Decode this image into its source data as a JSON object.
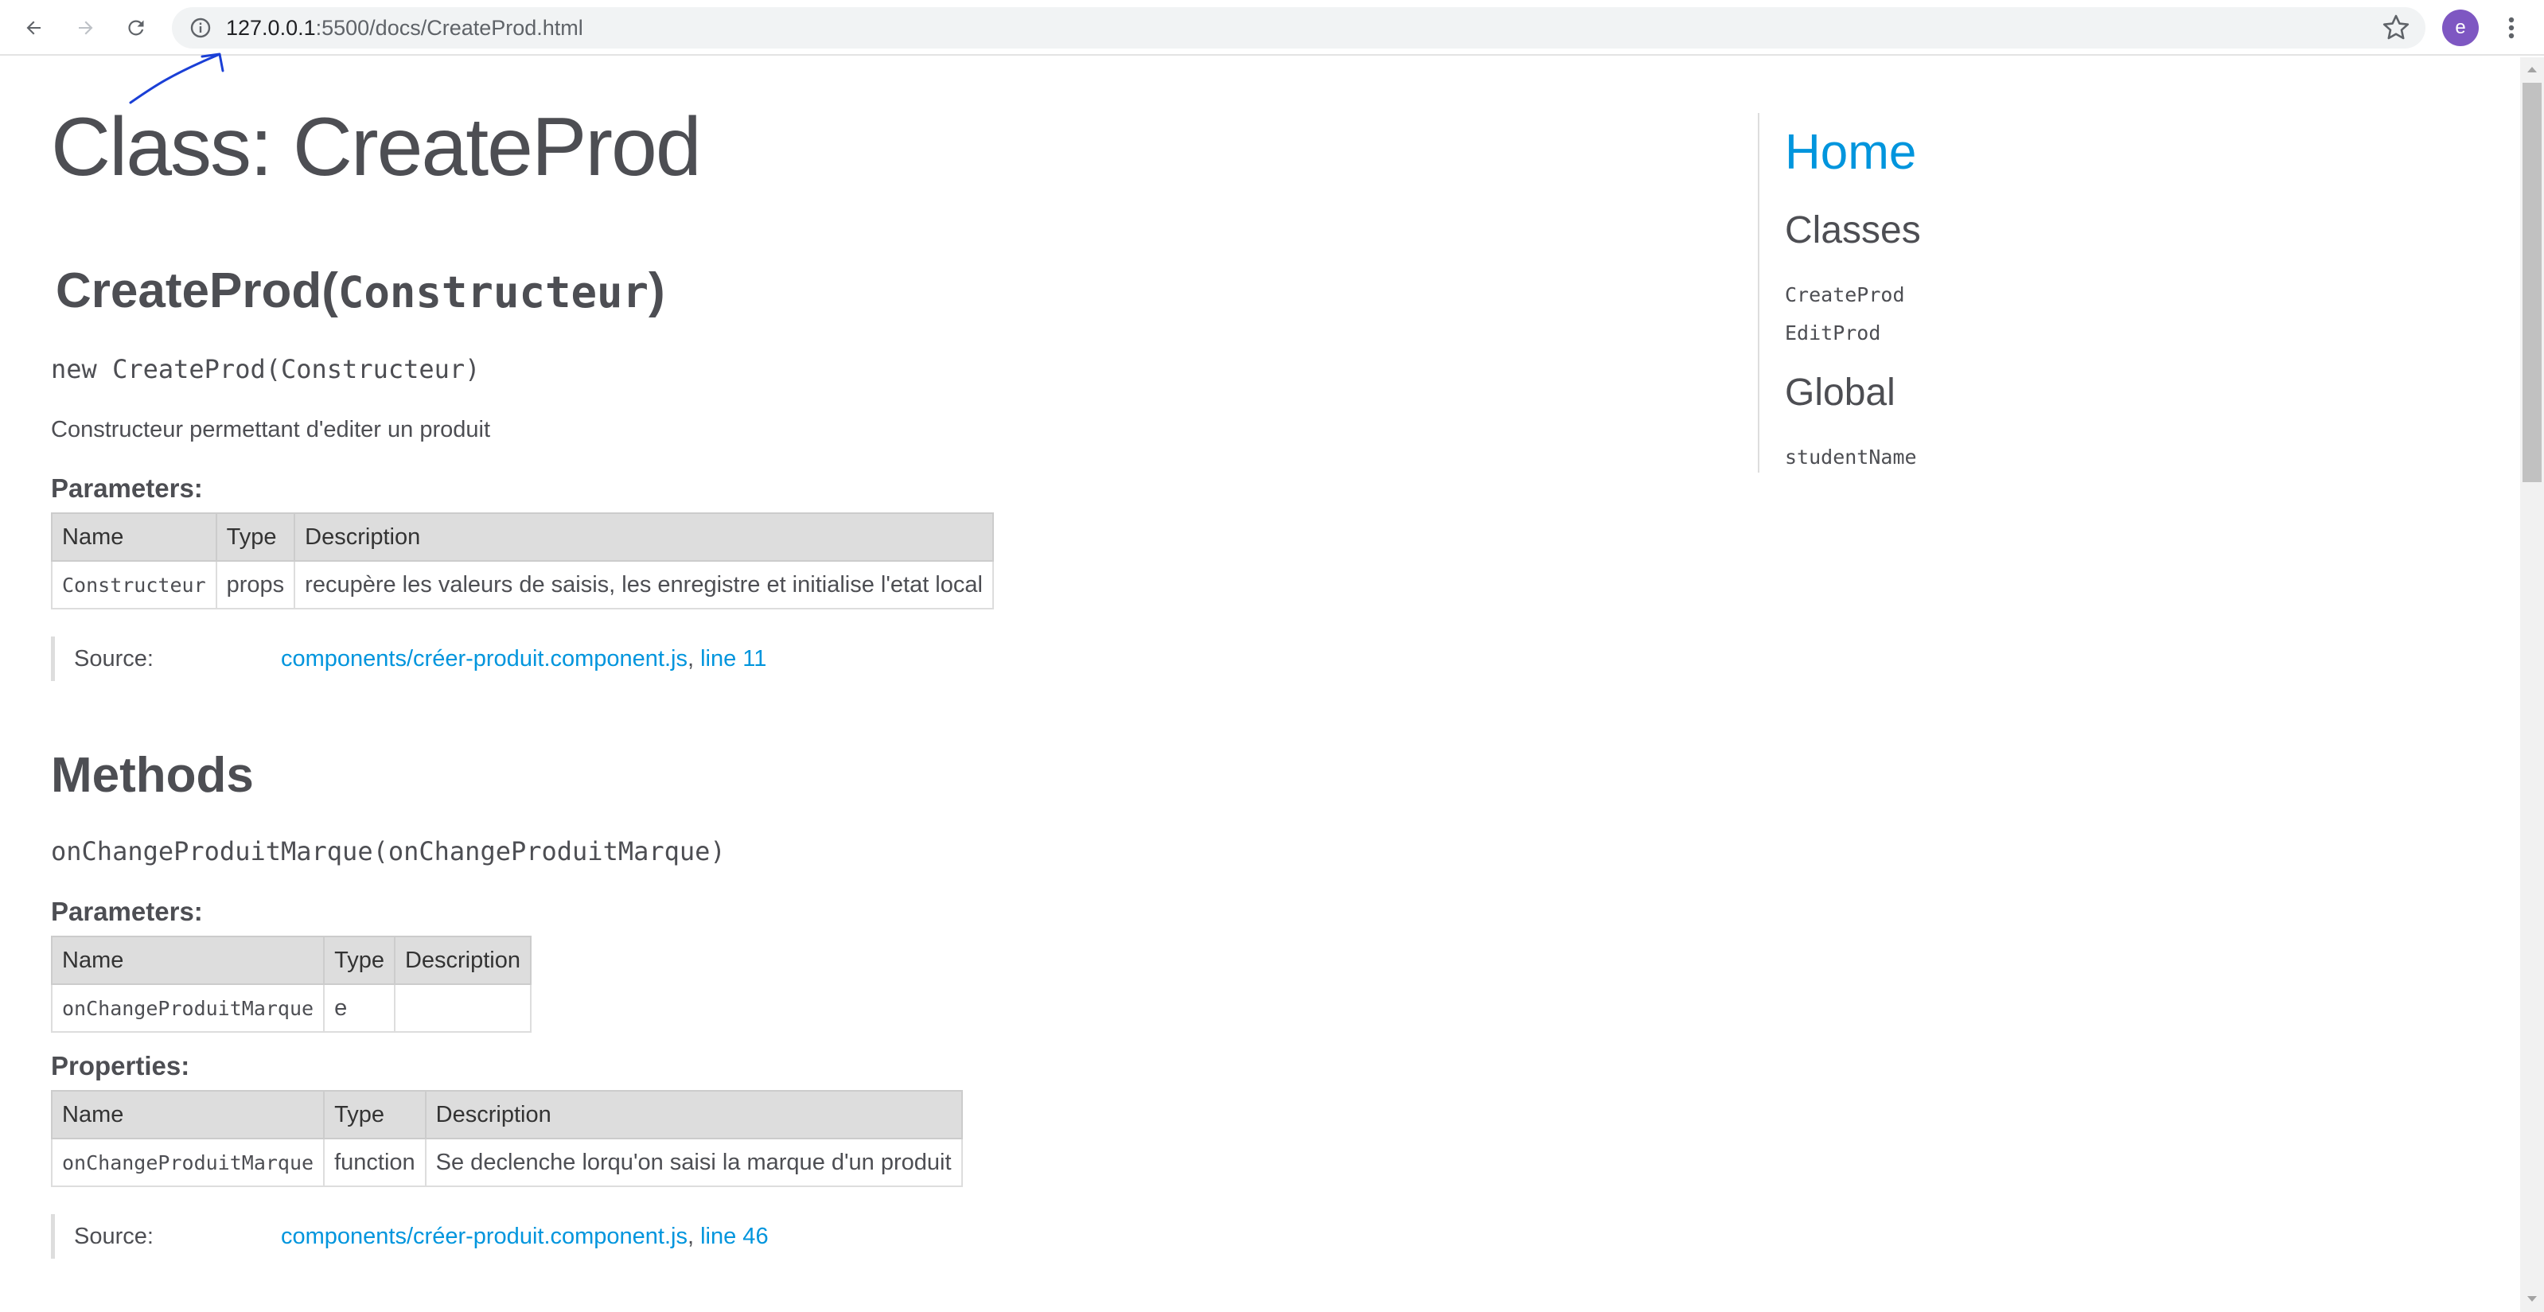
{
  "browser": {
    "url_host": "127.0.0.1",
    "url_rest": ":5500/docs/CreateProd.html",
    "profile_initial": "e",
    "icons": {
      "back": "arrow-left-icon",
      "forward": "arrow-right-icon",
      "reload": "reload-icon",
      "site_info": "info-icon",
      "bookmark": "star-icon",
      "menu": "kebab-menu-icon"
    },
    "accent_color": "#7e57c2"
  },
  "page": {
    "title": "Class: CreateProd",
    "constructor": {
      "name": "CreateProd(",
      "param": "Constructeur",
      "close": ")",
      "signature": "new CreateProd(Constructeur)",
      "description": "Constructeur permettant d'editer un produit",
      "parameters_heading": "Parameters:",
      "table": {
        "headers": [
          "Name",
          "Type",
          "Description"
        ],
        "rows": [
          [
            "Constructeur",
            "props",
            "recupère les valeurs de saisis, les enregistre et initialise l'etat local"
          ]
        ]
      },
      "source": {
        "label": "Source:",
        "file": "components/créer-produit.component.js",
        "sep": ",",
        "line": "line 11"
      }
    },
    "methods": {
      "heading": "Methods",
      "signature": "onChangeProduitMarque(onChangeProduitMarque)",
      "parameters_heading": "Parameters:",
      "params_table": {
        "headers": [
          "Name",
          "Type",
          "Description"
        ],
        "rows": [
          [
            "onChangeProduitMarque",
            "e",
            ""
          ]
        ]
      },
      "properties_heading": "Properties:",
      "props_table": {
        "headers": [
          "Name",
          "Type",
          "Description"
        ],
        "rows": [
          [
            "onChangeProduitMarque",
            "function",
            "Se declenche lorqu'on saisi la marque d'un produit"
          ]
        ]
      },
      "source": {
        "label": "Source:",
        "file": "components/créer-produit.component.js",
        "sep": ",",
        "line": "line 46"
      }
    }
  },
  "sidenav": {
    "home": "Home",
    "classes_heading": "Classes",
    "classes": [
      "CreateProd",
      "EditProd"
    ],
    "global_heading": "Global",
    "globals": [
      "studentName"
    ],
    "link_color": "#0095dd"
  }
}
